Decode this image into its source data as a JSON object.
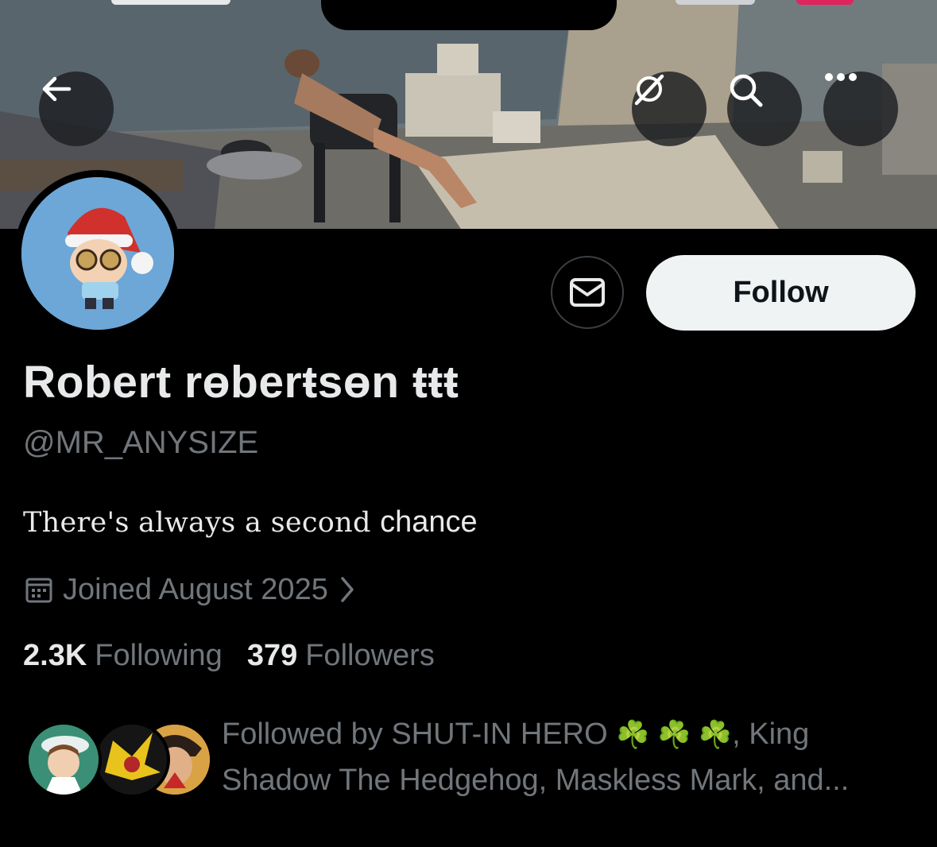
{
  "header": {
    "back_icon": "arrow-left-icon",
    "grok_icon": "grok-icon",
    "search_icon": "search-icon",
    "more_icon": "more-horizontal-icon"
  },
  "profile": {
    "display_name": "Robert rɵberŧsɵn ŧŧŧ",
    "handle": "@MR_ANYSIZE",
    "bio_part1": "There's always a second ",
    "bio_part2": "chance",
    "joined": "Joined August 2025",
    "following_count": "2.3K",
    "following_label": "Following",
    "followers_count": "379",
    "followers_label": "Followers",
    "followed_by_prefix": "Followed by SHUT-IN HERO ",
    "followed_by_emoji": "☘️ ☘️ ☘️",
    "followed_by_suffix": ", King Shadow The Hedgehog, Maskless Mark, and..."
  },
  "actions": {
    "follow_label": "Follow",
    "message_icon": "mail-icon"
  },
  "colors": {
    "background": "#000000",
    "primary_text": "#e7e9ea",
    "secondary_text": "#71767b",
    "follow_bg": "#eff3f4",
    "avatar_bg": "#6da7d8"
  }
}
